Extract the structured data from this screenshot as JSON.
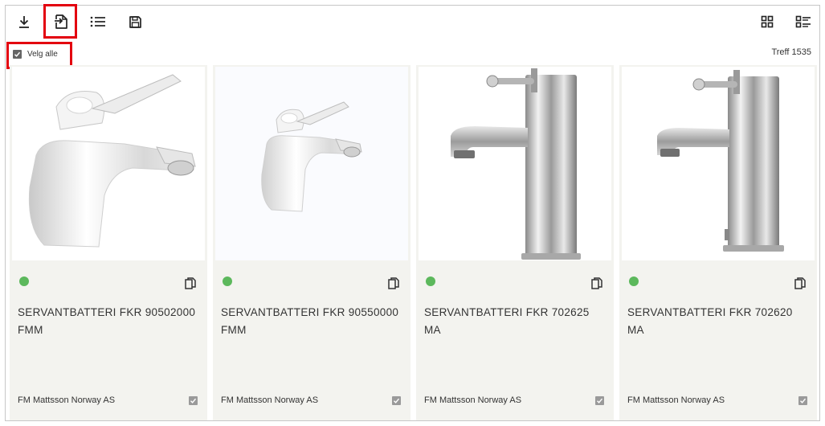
{
  "toolbar": {
    "download_icon": "download-icon",
    "export_icon": "export-icon",
    "list_icon": "list-icon",
    "save_icon": "save-icon",
    "grid_view_icon": "grid-view-icon",
    "list_view_icon": "list-view-icon"
  },
  "select_all": {
    "label": "Velg alle",
    "checked": true
  },
  "results": {
    "hits_label": "Treff 1535"
  },
  "products": [
    {
      "title": "SERVANTBATTERI FKR 90502000 FMM",
      "vendor": "FM Mattsson Norway AS",
      "status": "available",
      "status_color": "#5cb85c",
      "checked": true
    },
    {
      "title": "SERVANTBATTERI FKR 90550000 FMM",
      "vendor": "FM Mattsson Norway AS",
      "status": "available",
      "status_color": "#5cb85c",
      "checked": true
    },
    {
      "title": "SERVANTBATTERI FKR 702625 MA",
      "vendor": "FM Mattsson Norway AS",
      "status": "available",
      "status_color": "#5cb85c",
      "checked": true
    },
    {
      "title": "SERVANTBATTERI FKR 702620 MA",
      "vendor": "FM Mattsson Norway AS",
      "status": "available",
      "status_color": "#5cb85c",
      "checked": true
    }
  ],
  "colors": {
    "highlight": "#e3000f",
    "card_bg": "#f3f3ef",
    "status_green": "#5cb85c"
  }
}
